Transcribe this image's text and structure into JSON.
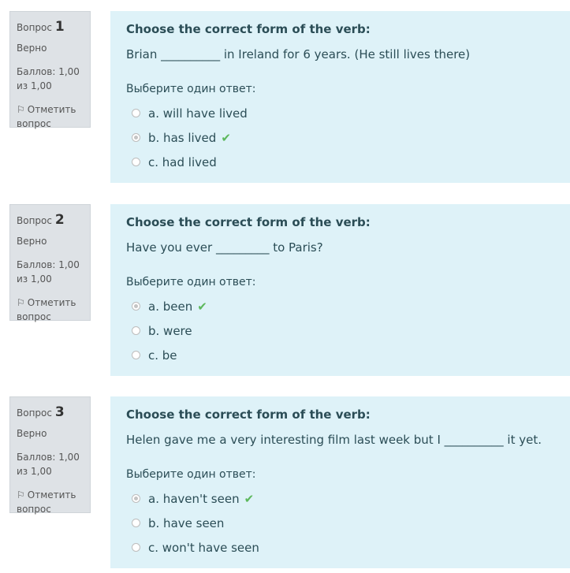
{
  "labels": {
    "question_label": "Вопрос",
    "state": "Верно",
    "grade": "Баллов: 1,00 из 1,00",
    "flag": "Отметить вопрос",
    "prompt": "Выберите один ответ:"
  },
  "colors": {
    "info_bg": "#dee2e6",
    "content_bg": "#def2f8",
    "correct_check": "#5cb85c"
  },
  "questions": [
    {
      "number": "1",
      "heading": "Choose the correct form of the verb:",
      "text": "Brian __________ in Ireland for 6 years. (He still lives there)",
      "options": [
        {
          "label": "a. will have lived",
          "selected": false,
          "correct": false
        },
        {
          "label": "b. has lived",
          "selected": true,
          "correct": true
        },
        {
          "label": "c. had lived",
          "selected": false,
          "correct": false
        }
      ]
    },
    {
      "number": "2",
      "heading": "Choose the correct form of the verb:",
      "text": "Have you ever _________ to Paris?",
      "options": [
        {
          "label": "a. been",
          "selected": true,
          "correct": true
        },
        {
          "label": "b. were",
          "selected": false,
          "correct": false
        },
        {
          "label": "c. be",
          "selected": false,
          "correct": false
        }
      ]
    },
    {
      "number": "3",
      "heading": "Choose the correct form of the verb:",
      "text": " Helen gave me a very interesting film last week but I __________ it yet.",
      "options": [
        {
          "label": "a. haven't seen",
          "selected": true,
          "correct": true
        },
        {
          "label": "b. have seen",
          "selected": false,
          "correct": false
        },
        {
          "label": "c. won't have seen",
          "selected": false,
          "correct": false
        }
      ]
    }
  ]
}
